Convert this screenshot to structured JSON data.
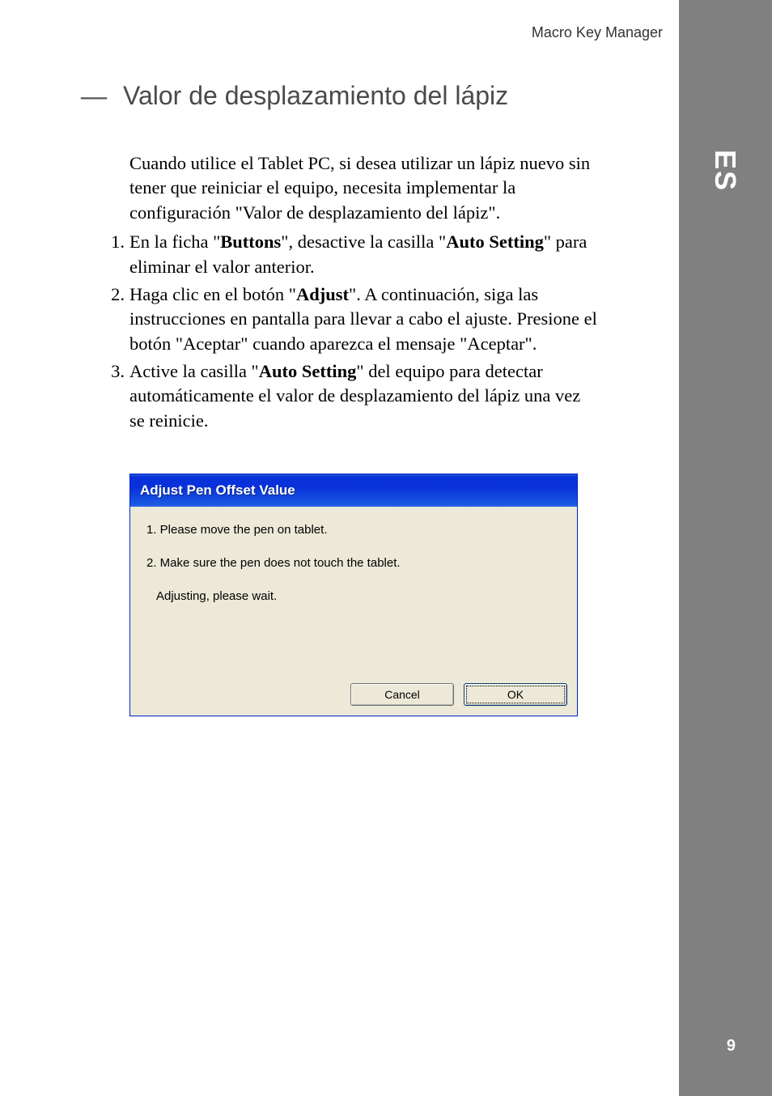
{
  "header": {
    "title": "Macro Key Manager"
  },
  "sidebar": {
    "lang": "ES",
    "page": "9"
  },
  "section": {
    "dash": "—",
    "heading": "Valor de desplazamiento del lápiz",
    "intro": "Cuando utilice el Tablet PC, si desea utilizar un lápiz nuevo sin tener que reiniciar el equipo, necesita implementar la configuración \"Valor de desplazamiento del lápiz\".",
    "items": [
      {
        "num": "1.",
        "pre": "En la ficha \"",
        "b1": "Buttons",
        "mid": "\", desactive la casilla \"",
        "b2": "Auto Setting",
        "post": "\" para eliminar el valor anterior."
      },
      {
        "num": "2.",
        "pre": "Haga clic en el botón \"",
        "b1": "Adjust",
        "mid": "",
        "b2": "",
        "post": "\". A continuación, siga las instrucciones en pantalla para llevar a cabo el ajuste. Presione el botón \"Aceptar\" cuando aparezca el mensaje \"Aceptar\"."
      },
      {
        "num": "3.",
        "pre": "Active la casilla \"",
        "b1": "Auto Setting",
        "mid": "",
        "b2": "",
        "post": "\" del equipo para detectar automáticamente el valor de desplazamiento del lápiz una vez se reinicie."
      }
    ]
  },
  "dialog": {
    "title": "Adjust Pen Offset Value",
    "line1": "1. Please move the pen on tablet.",
    "line2": "2. Make sure the pen does not touch the tablet.",
    "line3": "Adjusting, please wait.",
    "cancel": "Cancel",
    "ok": "OK"
  }
}
